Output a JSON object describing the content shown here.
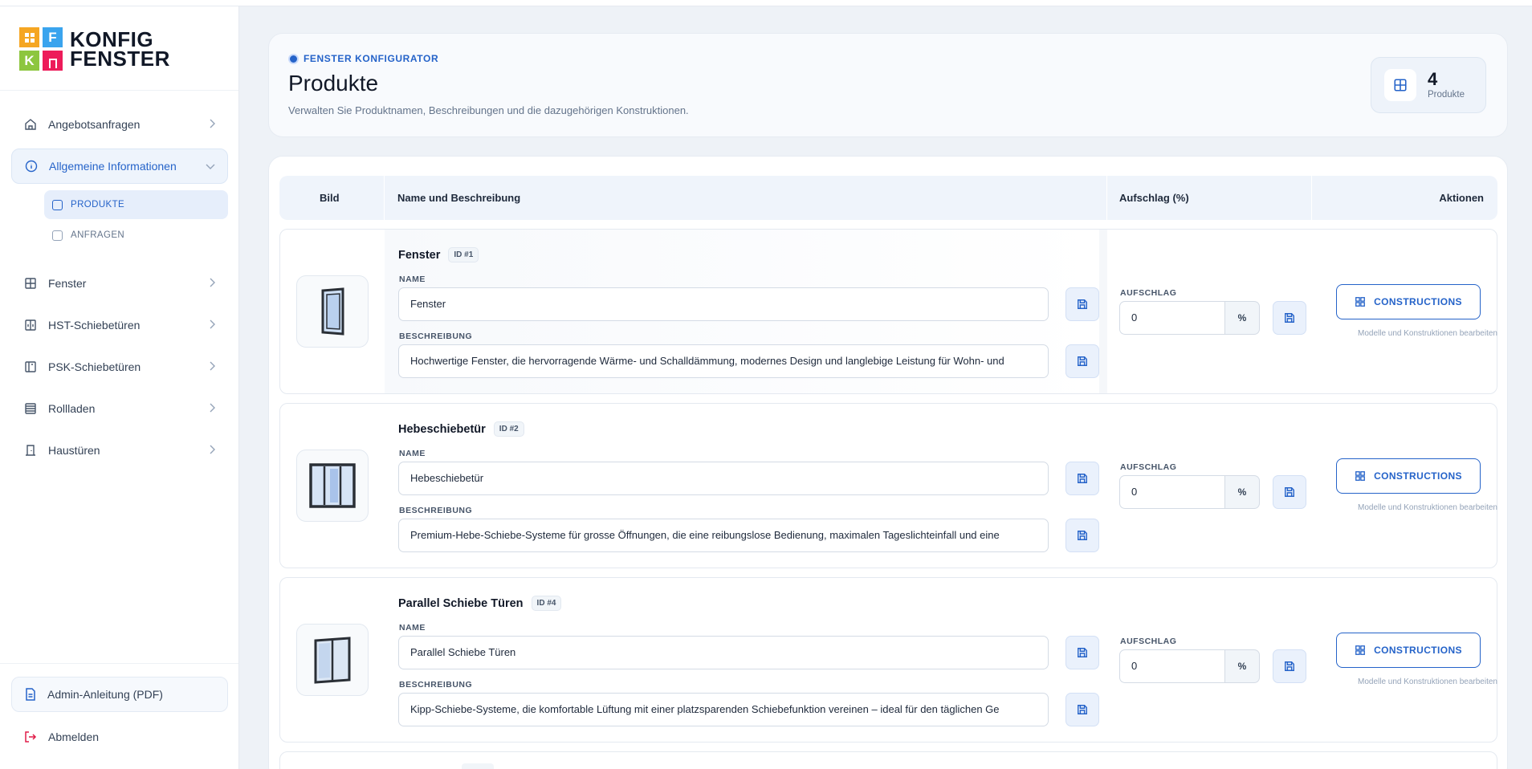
{
  "brand": {
    "logo_letters": [
      "F",
      "K"
    ],
    "name_line1": "KONFIG",
    "name_line2": "FENSTER"
  },
  "sidebar": {
    "items": [
      {
        "label": "Angebotsanfragen",
        "icon": "home-icon"
      },
      {
        "label": "Allgemeine Informationen",
        "icon": "info-icon",
        "active": true
      },
      {
        "label": "Fenster",
        "icon": "window-icon"
      },
      {
        "label": "HST-Schiebetüren",
        "icon": "sliding-door-icon"
      },
      {
        "label": "PSK-Schiebetüren",
        "icon": "psk-door-icon"
      },
      {
        "label": "Rollladen",
        "icon": "shutter-icon"
      },
      {
        "label": "Haustüren",
        "icon": "door-icon"
      }
    ],
    "subitems": [
      {
        "label": "PRODUKTE",
        "active": true
      },
      {
        "label": "ANFRAGEN"
      }
    ],
    "pdf_label": "Admin-Anleitung (PDF)",
    "logout_label": "Abmelden"
  },
  "header": {
    "eyebrow": "FENSTER KONFIGURATOR",
    "title": "Produkte",
    "subtitle": "Verwalten Sie Produktnamen, Beschreibungen und die dazugehörigen Konstruktionen.",
    "count": "4",
    "count_label": "Produkte"
  },
  "table": {
    "columns": [
      "Bild",
      "Name und Beschreibung",
      "Aufschlag (%)",
      "Aktionen"
    ],
    "name_label": "NAME",
    "desc_label": "BESCHREIBUNG",
    "markup_label": "AUFSCHLAG",
    "percent_suffix": "%",
    "constructions_label": "CONSTRUCTIONS",
    "constructions_hint": "Modelle und Konstruktionen bearbeiten",
    "rows": [
      {
        "title": "Fenster",
        "id": "ID #1",
        "name": "Fenster",
        "description": "Hochwertige Fenster, die hervorragende Wärme- und Schalldämmung, modernes Design und langlebige Leistung für Wohn- und",
        "markup": "0"
      },
      {
        "title": "Hebeschiebetür",
        "id": "ID #2",
        "name": "Hebeschiebetür",
        "description": "Premium-Hebe-Schiebe-Systeme für grosse Öffnungen, die eine reibungslose Bedienung, maximalen Tageslichteinfall und eine",
        "markup": "0"
      },
      {
        "title": "Parallel Schiebe Türen",
        "id": "ID #4",
        "name": "Parallel Schiebe Türen",
        "description": "Kipp-Schiebe-Systeme, die komfortable Lüftung mit einer platzsparenden Schiebefunktion vereinen – ideal für den täglichen Ge",
        "markup": "0"
      }
    ]
  },
  "colors": {
    "accent": "#2563c9",
    "logout": "#e11d48",
    "logo_orange": "#f5a623",
    "logo_blue": "#3aa4ee",
    "logo_green": "#8dc63f",
    "logo_red": "#ed1c5a"
  }
}
